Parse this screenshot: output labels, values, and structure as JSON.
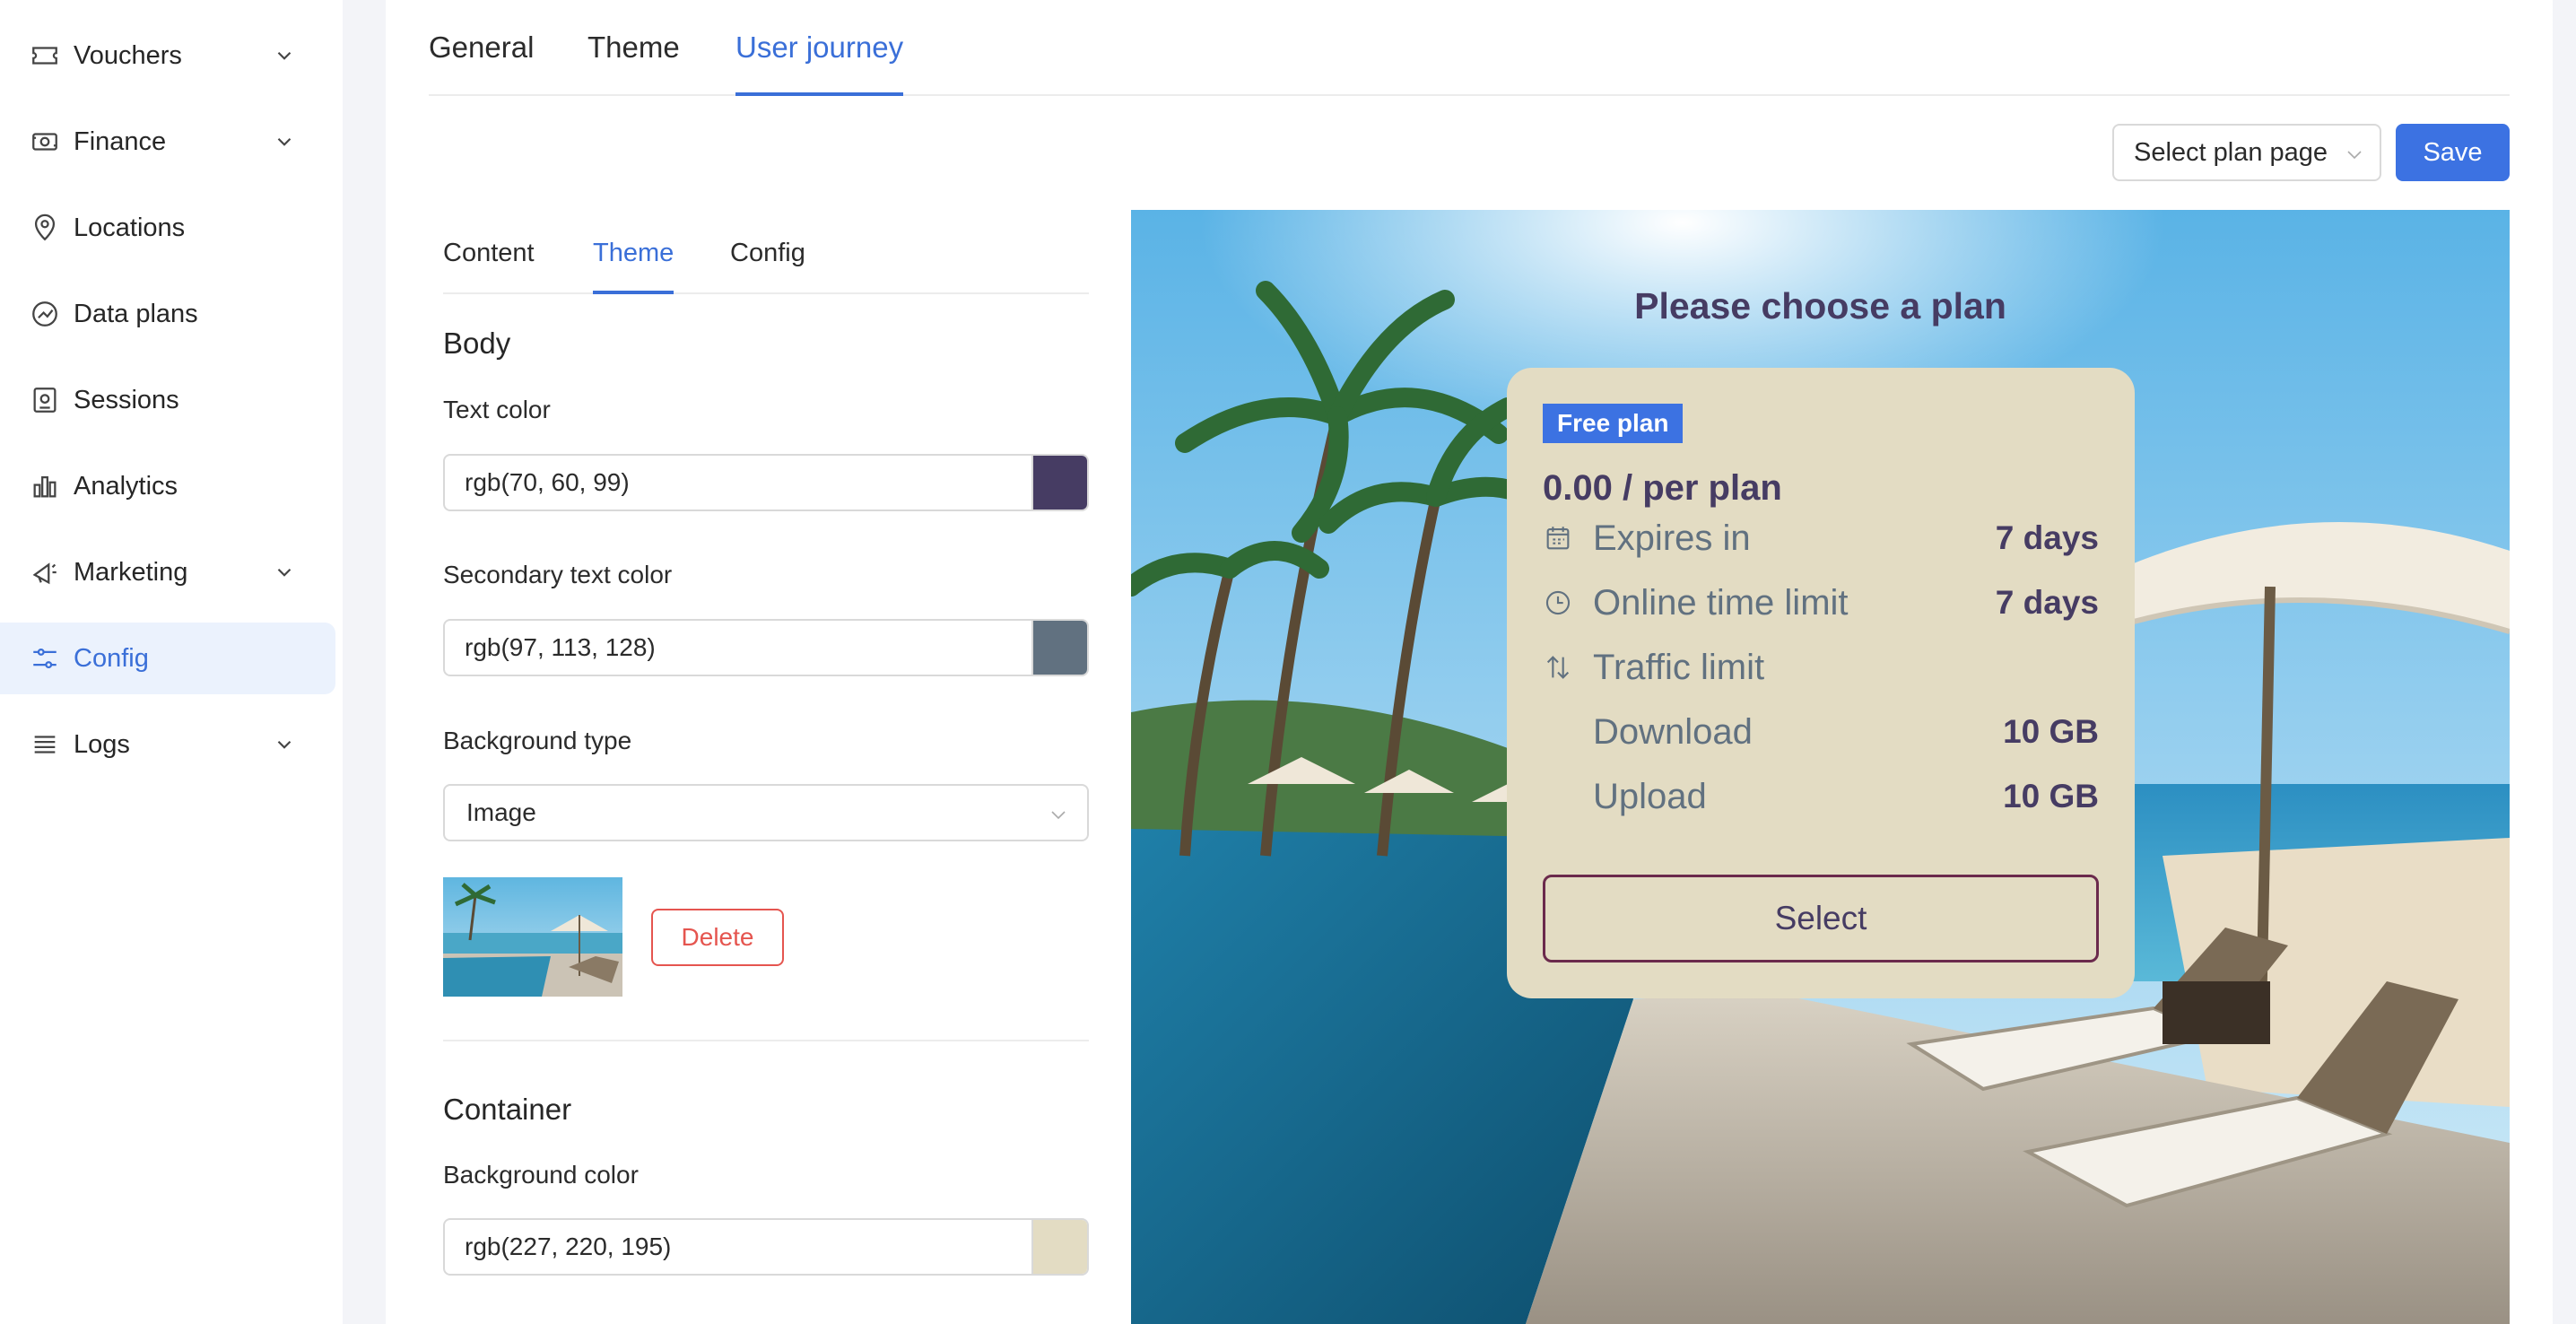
{
  "sidebar": {
    "items": [
      {
        "label": "Vouchers",
        "icon": "ticket-icon",
        "expandable": true
      },
      {
        "label": "Finance",
        "icon": "money-icon",
        "expandable": true
      },
      {
        "label": "Locations",
        "icon": "location-pin-icon",
        "expandable": false
      },
      {
        "label": "Data plans",
        "icon": "data-plans-icon",
        "expandable": false
      },
      {
        "label": "Sessions",
        "icon": "sessions-icon",
        "expandable": false
      },
      {
        "label": "Analytics",
        "icon": "bar-chart-icon",
        "expandable": false
      },
      {
        "label": "Marketing",
        "icon": "megaphone-icon",
        "expandable": true
      },
      {
        "label": "Config",
        "icon": "sliders-icon",
        "expandable": false,
        "active": true
      },
      {
        "label": "Logs",
        "icon": "list-icon",
        "expandable": true
      }
    ]
  },
  "tabs": [
    {
      "label": "General"
    },
    {
      "label": "Theme"
    },
    {
      "label": "User journey",
      "active": true
    }
  ],
  "toolbar": {
    "page_select": "Select plan page",
    "save_label": "Save"
  },
  "settings": {
    "tabs": [
      {
        "label": "Content"
      },
      {
        "label": "Theme",
        "active": true
      },
      {
        "label": "Config"
      }
    ],
    "body": {
      "title": "Body",
      "text_color_label": "Text color",
      "text_color_value": "rgb(70, 60, 99)",
      "text_color_hex": "#463c63",
      "secondary_label": "Secondary text color",
      "secondary_value": "rgb(97, 113, 128)",
      "secondary_hex": "#617180",
      "bg_type_label": "Background type",
      "bg_type_value": "Image",
      "delete_label": "Delete"
    },
    "container": {
      "title": "Container",
      "bg_color_label": "Background color",
      "bg_color_value": "rgb(227, 220, 195)",
      "bg_color_hex": "#e3dcc3"
    }
  },
  "preview": {
    "title": "Please choose a plan",
    "plan": {
      "badge": "Free plan",
      "price": "0.00 / per plan",
      "rows": [
        {
          "label": "Expires in",
          "value": "7 days",
          "icon": "calendar-icon"
        },
        {
          "label": "Online time limit",
          "value": "7 days",
          "icon": "clock-icon"
        },
        {
          "label": "Traffic limit",
          "value": "",
          "icon": "transfer-arrows-icon"
        },
        {
          "label": "Download",
          "value": "10 GB"
        },
        {
          "label": "Upload",
          "value": "10 GB"
        }
      ],
      "select_label": "Select"
    }
  }
}
